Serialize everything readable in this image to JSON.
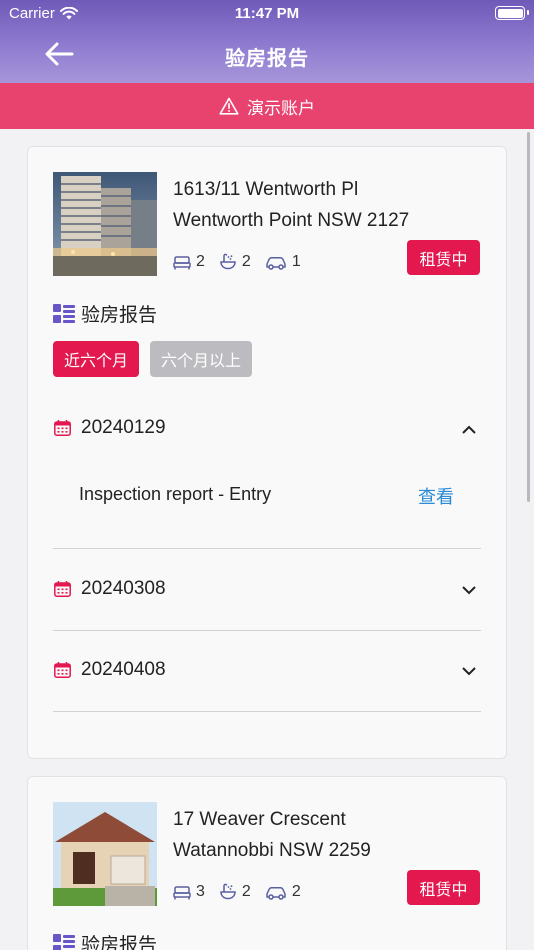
{
  "status_bar": {
    "carrier": "Carrier",
    "time": "11:47 PM"
  },
  "nav": {
    "title": "验房报告"
  },
  "banner": {
    "text": "演示账户"
  },
  "properties": [
    {
      "address_line1": "1613/11 Wentworth Pl",
      "address_line2": "Wentworth Point NSW 2127",
      "bedrooms": "2",
      "bathrooms": "2",
      "parking": "1",
      "status": "租赁中",
      "section_title": "验房报告",
      "filters": [
        "近六个月",
        "六个月以上"
      ],
      "inspections": [
        {
          "date": "20240129",
          "expanded": true,
          "report": "Inspection report - Entry",
          "action": "查看"
        },
        {
          "date": "20240308",
          "expanded": false
        },
        {
          "date": "20240408",
          "expanded": false
        }
      ]
    },
    {
      "address_line1": "17 Weaver Crescent",
      "address_line2": "Watannobbi NSW 2259",
      "bedrooms": "3",
      "bathrooms": "2",
      "parking": "2",
      "status": "租赁中",
      "section_title": "验房报告"
    }
  ],
  "colors": {
    "header_top": "#6f5ab8",
    "banner": "#e8426f",
    "status_tag": "#e2184f",
    "link": "#2a8ad6",
    "accent_icon": "#6a55c8"
  }
}
